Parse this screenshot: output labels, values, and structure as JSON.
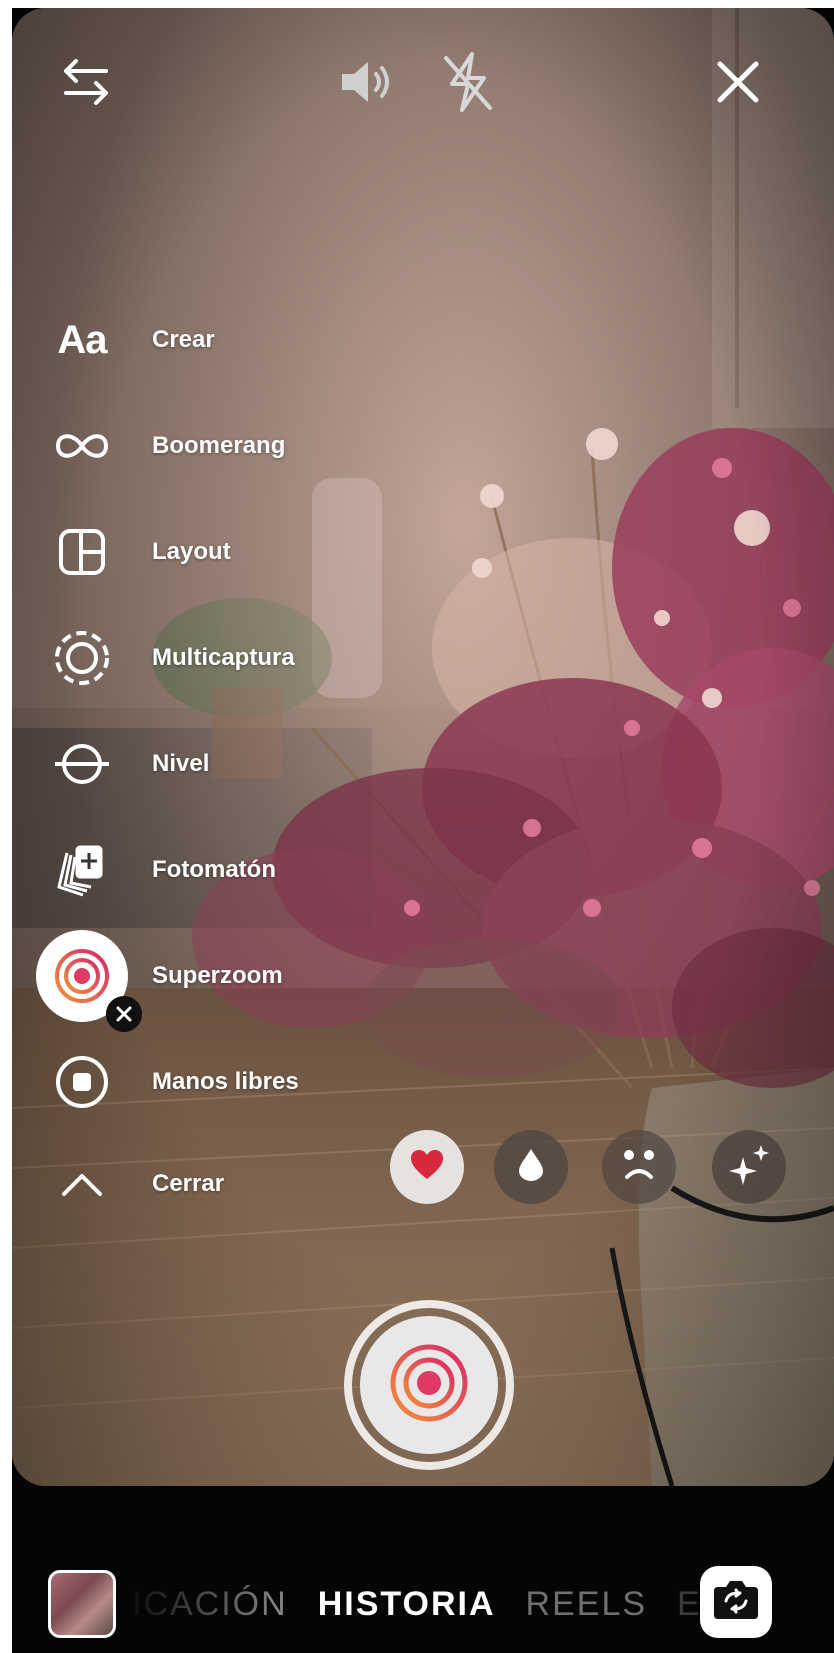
{
  "top_bar": {
    "swap_icon": "swap-arrows-icon",
    "sound_icon": "speaker-icon",
    "flash_icon": "flash-off-icon",
    "close_icon": "close-icon"
  },
  "tools_menu": {
    "items": [
      {
        "label": "Crear",
        "icon": "text-aa-icon",
        "icon_text": "Aa"
      },
      {
        "label": "Boomerang",
        "icon": "infinity-icon"
      },
      {
        "label": "Layout",
        "icon": "layout-grid-icon"
      },
      {
        "label": "Multicaptura",
        "icon": "multicapture-icon"
      },
      {
        "label": "Nivel",
        "icon": "level-icon"
      },
      {
        "label": "Fotomatón",
        "icon": "photobooth-icon"
      },
      {
        "label": "Superzoom",
        "icon": "superzoom-icon",
        "selected": true
      },
      {
        "label": "Manos libres",
        "icon": "hands-free-icon"
      },
      {
        "label": "Cerrar",
        "icon": "chevron-up-icon"
      }
    ]
  },
  "effects": [
    {
      "name": "heart-effect",
      "icon": "heart-icon",
      "selected": true
    },
    {
      "name": "fire-effect",
      "icon": "drop-icon"
    },
    {
      "name": "sad-effect",
      "icon": "sad-face-icon"
    },
    {
      "name": "sparkle-effect",
      "icon": "sparkles-icon"
    }
  ],
  "capture": {
    "icon": "superzoom-icon"
  },
  "bottom_bar": {
    "modes": [
      "ICACIÓN",
      "HISTORIA",
      "REELS",
      "E"
    ],
    "active_mode": "HISTORIA",
    "flip_icon": "camera-flip-icon",
    "gallery_icon": "gallery-thumbnail"
  },
  "colors": {
    "accent_pink": "#e03a64",
    "accent_orange": "#f0903a",
    "heart_red": "#d8283c"
  }
}
